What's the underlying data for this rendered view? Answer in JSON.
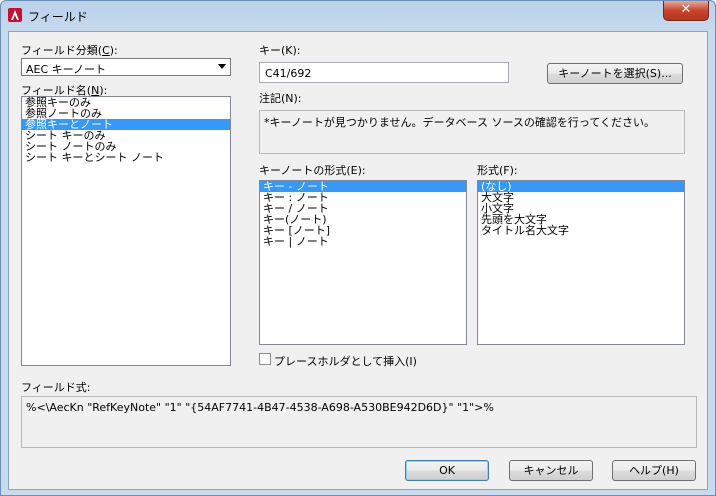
{
  "window": {
    "title": "フィールド"
  },
  "field_category": {
    "label": "フィールド分類(",
    "label_key": "C",
    "label_end": "):",
    "selected": "AEC キーノート"
  },
  "field_name": {
    "label": "フィールド名(",
    "label_key": "N",
    "label_end": "):",
    "items": [
      "参照キーのみ",
      "参照ノートのみ",
      "参照キーとノート",
      "シート キーのみ",
      "シート ノートのみ",
      "シート キーとシート ノート"
    ],
    "selected_index": 2
  },
  "key": {
    "label": "キー(K):",
    "value": "C41/692"
  },
  "select_keynote_button": "キーノートを選択(S)...",
  "note": {
    "label": "注記(N):",
    "value": "*キーノートが見つかりません。データベース ソースの確認を行ってください。"
  },
  "keynote_format": {
    "label": "キーノートの形式(E):",
    "items": [
      "キー - ノート",
      "キー : ノート",
      "キー / ノート",
      "キー(ノート)",
      "キー [ノート]",
      "キー | ノート"
    ],
    "selected_index": 0
  },
  "format": {
    "label": "形式(F):",
    "items": [
      "(なし)",
      "大文字",
      "小文字",
      "先頭を大文字",
      "タイトル名大文字"
    ],
    "selected_index": 0
  },
  "placeholder_checkbox": {
    "label": "プレースホルダとして挿入(I)",
    "checked": false
  },
  "field_expression": {
    "label": "フィールド式:",
    "value": "%<\\AecKn \"RefKeyNote\" \"1\" \"{54AF7741-4B47-4538-A698-A530BE942D6D}\" \"1\">%"
  },
  "buttons": {
    "ok": "OK",
    "cancel": "キャンセル",
    "help": "ヘルプ(H)"
  },
  "colors": {
    "selection": "#3399ff",
    "title_close": "#c7452b"
  }
}
